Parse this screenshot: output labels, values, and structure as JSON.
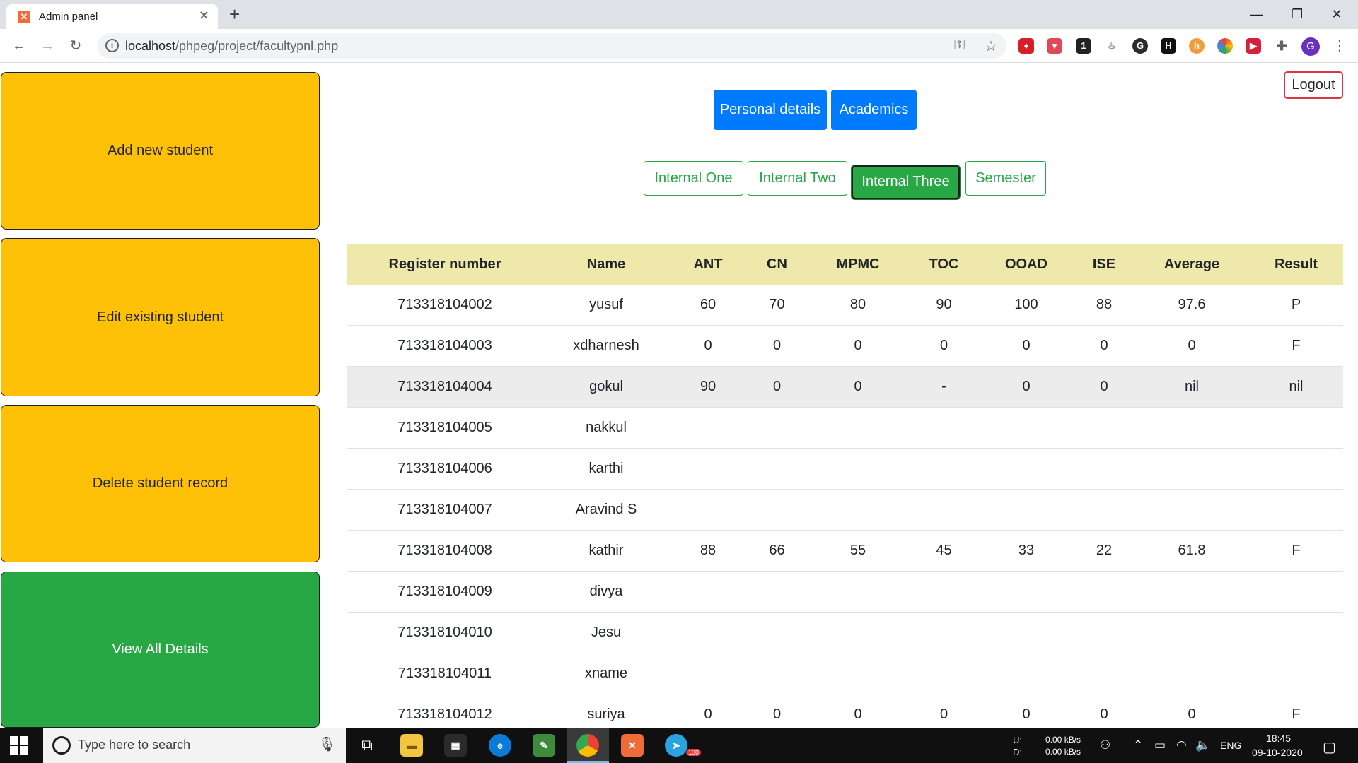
{
  "browser": {
    "tab_title": "Admin panel",
    "url_host": "localhost",
    "url_path": "/phpeg/project/facultypnl.php"
  },
  "sidebar": {
    "add": "Add new student",
    "edit": "Edit existing student",
    "delete": "Delete student record",
    "view": "View All Details"
  },
  "header": {
    "logout": "Logout",
    "personal": "Personal details",
    "academics": "Academics"
  },
  "exams": {
    "one": "Internal One",
    "two": "Internal Two",
    "three": "Internal Three",
    "semester": "Semester",
    "active": "Internal Three"
  },
  "table": {
    "headers": [
      "Register number",
      "Name",
      "ANT",
      "CN",
      "MPMC",
      "TOC",
      "OOAD",
      "ISE",
      "Average",
      "Result"
    ],
    "rows": [
      [
        "713318104002",
        "yusuf",
        "60",
        "70",
        "80",
        "90",
        "100",
        "88",
        "97.6",
        "P"
      ],
      [
        "713318104003",
        "xdharnesh",
        "0",
        "0",
        "0",
        "0",
        "0",
        "0",
        "0",
        "F"
      ],
      [
        "713318104004",
        "gokul",
        "90",
        "0",
        "0",
        "-",
        "0",
        "0",
        "nil",
        "nil"
      ],
      [
        "713318104005",
        "nakkul",
        "",
        "",
        "",
        "",
        "",
        "",
        "",
        ""
      ],
      [
        "713318104006",
        "karthi",
        "",
        "",
        "",
        "",
        "",
        "",
        "",
        ""
      ],
      [
        "713318104007",
        "Aravind S",
        "",
        "",
        "",
        "",
        "",
        "",
        "",
        ""
      ],
      [
        "713318104008",
        "kathir",
        "88",
        "66",
        "55",
        "45",
        "33",
        "22",
        "61.8",
        "F"
      ],
      [
        "713318104009",
        "divya",
        "",
        "",
        "",
        "",
        "",
        "",
        "",
        ""
      ],
      [
        "713318104010",
        "Jesu",
        "",
        "",
        "",
        "",
        "",
        "",
        "",
        ""
      ],
      [
        "713318104011",
        "xname",
        "",
        "",
        "",
        "",
        "",
        "",
        "",
        ""
      ],
      [
        "713318104012",
        "suriya",
        "0",
        "0",
        "0",
        "0",
        "0",
        "0",
        "0",
        "F"
      ]
    ]
  },
  "taskbar": {
    "search_placeholder": "Type here to search",
    "net_up_label": "U:",
    "net_down_label": "D:",
    "net_up": "0.00 kB/s",
    "net_down": "0.00 kB/s",
    "lang": "ENG",
    "time": "18:45",
    "date": "09-10-2020",
    "telegram_badge": "100",
    "ext_badge": "1"
  },
  "colors": {
    "warning": "#ffc107",
    "success": "#28a745",
    "primary": "#007bff",
    "danger": "#dc3545",
    "table_header": "#eee8aa"
  }
}
